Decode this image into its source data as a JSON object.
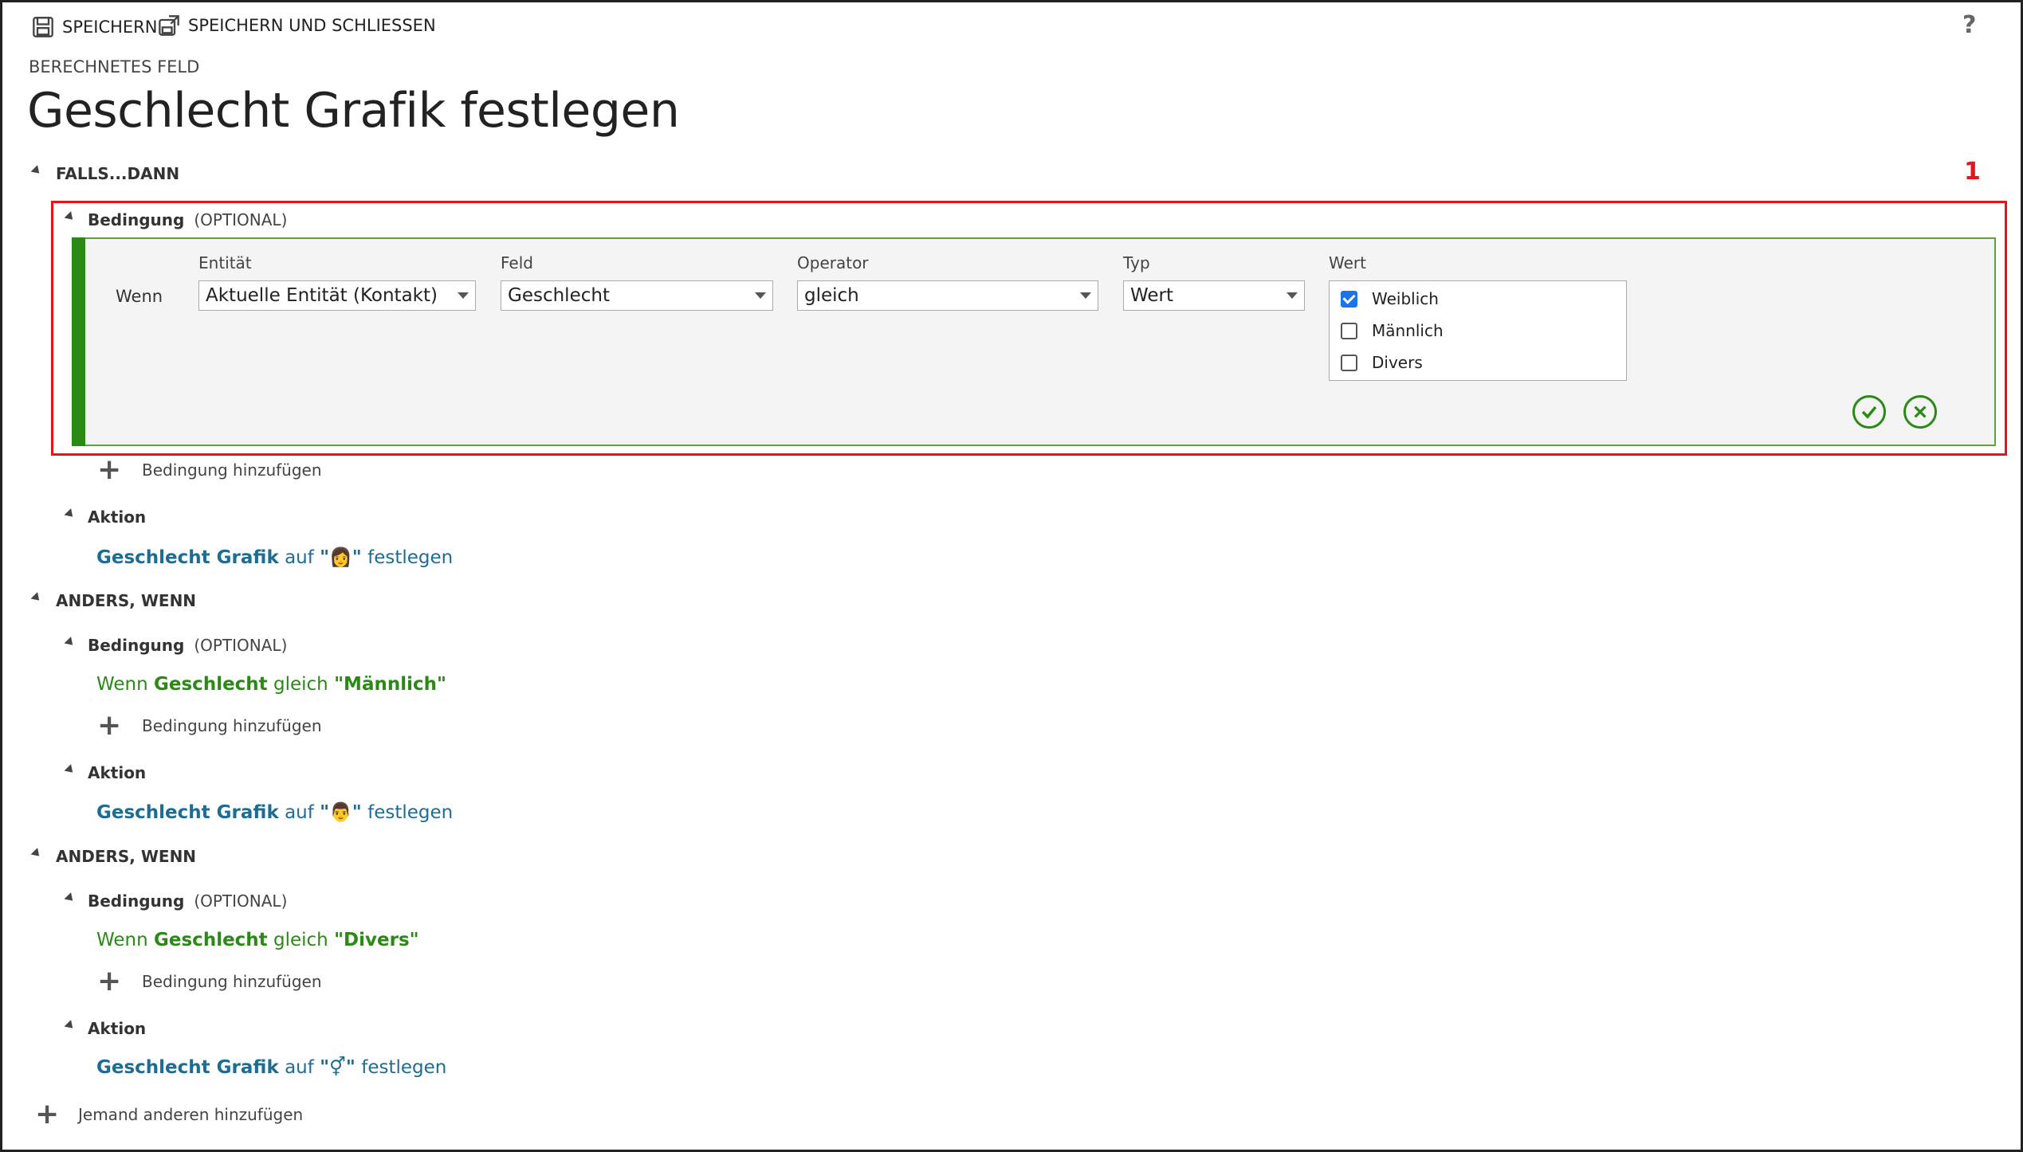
{
  "toolbar": {
    "save_label": "SPEICHERN",
    "save_close_label": "SPEICHERN UND SCHLIESSEN",
    "help_label": "?"
  },
  "header": {
    "kicker": "BERECHNETES FELD",
    "title": "Geschlecht Grafik festlegen"
  },
  "callout_number": "1",
  "if_block": {
    "title": "FALLS...DANN",
    "condition_title": "Bedingung",
    "optional_label": "(OPTIONAL)",
    "editor": {
      "wenn_label": "Wenn",
      "entity_label": "Entität",
      "entity_value": "Aktuelle Entität (Kontakt)",
      "field_label": "Feld",
      "field_value": "Geschlecht",
      "operator_label": "Operator",
      "operator_value": "gleich",
      "type_label": "Typ",
      "type_value": "Wert",
      "value_label": "Wert",
      "options": [
        {
          "label": "Weiblich",
          "checked": true
        },
        {
          "label": "Männlich",
          "checked": false
        },
        {
          "label": "Divers",
          "checked": false
        }
      ]
    },
    "add_condition_label": "Bedingung hinzufügen",
    "action_title": "Aktion",
    "action": {
      "field": "Geschlecht Grafik",
      "auf": "auf",
      "quote_open": "\"",
      "quote_close": "\"",
      "emoji": "👩",
      "festlegen": "festlegen"
    }
  },
  "else_blocks": [
    {
      "title": "ANDERS, WENN",
      "condition_title": "Bedingung",
      "optional_label": "(OPTIONAL)",
      "condition": {
        "wenn": "Wenn",
        "field": "Geschlecht",
        "op": "gleich",
        "value": "\"Männlich\""
      },
      "add_condition_label": "Bedingung hinzufügen",
      "action_title": "Aktion",
      "action": {
        "field": "Geschlecht Grafik",
        "auf": "auf",
        "quote_open": "\"",
        "quote_close": "\"",
        "emoji": "👨",
        "festlegen": "festlegen"
      }
    },
    {
      "title": "ANDERS, WENN",
      "condition_title": "Bedingung",
      "optional_label": "(OPTIONAL)",
      "condition": {
        "wenn": "Wenn",
        "field": "Geschlecht",
        "op": "gleich",
        "value": "\"Divers\""
      },
      "add_condition_label": "Bedingung hinzufügen",
      "action_title": "Aktion",
      "action": {
        "field": "Geschlecht Grafik",
        "auf": "auf",
        "quote_open": "\"",
        "quote_close": "\"",
        "emoji": "⚥",
        "festlegen": "festlegen"
      }
    }
  ],
  "add_other_label": "Jemand anderen hinzufügen",
  "colors": {
    "callout": "#e8141c",
    "condition_green": "#2b8a16",
    "action_blue": "#1d6c94"
  }
}
